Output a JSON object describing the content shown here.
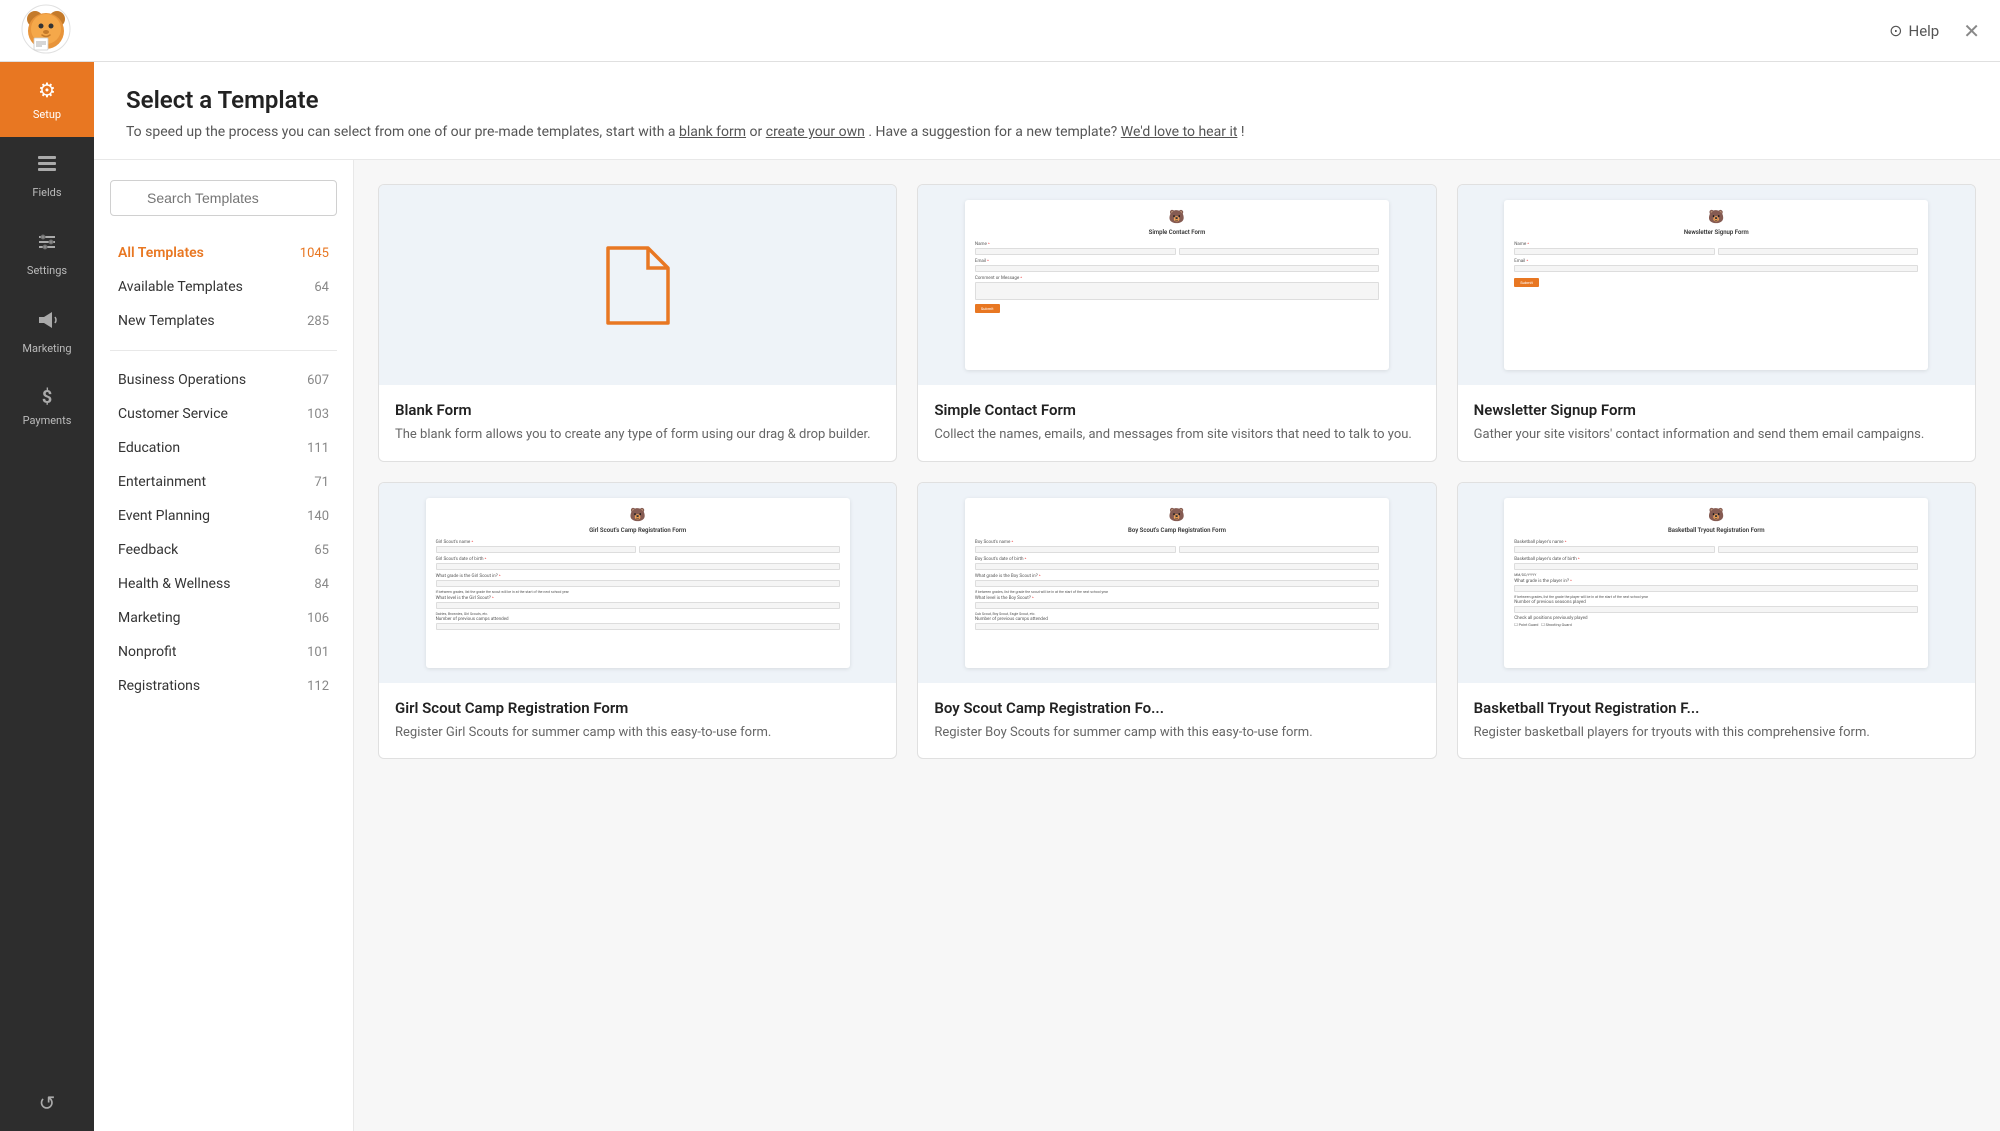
{
  "topbar": {
    "help_label": "Help",
    "close_label": "✕"
  },
  "left_nav": {
    "items": [
      {
        "id": "setup",
        "label": "Setup",
        "icon": "⚙",
        "active": true
      },
      {
        "id": "fields",
        "label": "Fields",
        "icon": "▤",
        "active": false
      },
      {
        "id": "settings",
        "label": "Settings",
        "icon": "⇌",
        "active": false
      },
      {
        "id": "marketing",
        "label": "Marketing",
        "icon": "📣",
        "active": false
      },
      {
        "id": "payments",
        "label": "Payments",
        "icon": "$",
        "active": false
      }
    ],
    "bottom_items": [
      {
        "id": "history",
        "label": "",
        "icon": "↺",
        "active": false
      }
    ]
  },
  "page": {
    "title": "Select a Template",
    "subtitle_prefix": "To speed up the process you can select from one of our pre-made templates, start with a ",
    "blank_form_link": "blank form",
    "subtitle_or": " or ",
    "create_link": "create your own",
    "subtitle_suffix": ". Have a suggestion for a new template? ",
    "suggestion_link": "We'd love to hear it",
    "subtitle_end": "!"
  },
  "filter": {
    "search_placeholder": "Search Templates",
    "filter_groups": [
      {
        "id": "all",
        "label": "All Templates",
        "count": "1045",
        "active": true
      },
      {
        "id": "available",
        "label": "Available Templates",
        "count": "64",
        "active": false
      },
      {
        "id": "new",
        "label": "New Templates",
        "count": "285",
        "active": false
      }
    ],
    "categories": [
      {
        "id": "business",
        "label": "Business Operations",
        "count": "607"
      },
      {
        "id": "customer",
        "label": "Customer Service",
        "count": "103"
      },
      {
        "id": "education",
        "label": "Education",
        "count": "111"
      },
      {
        "id": "entertainment",
        "label": "Entertainment",
        "count": "71"
      },
      {
        "id": "event",
        "label": "Event Planning",
        "count": "140"
      },
      {
        "id": "feedback",
        "label": "Feedback",
        "count": "65"
      },
      {
        "id": "health",
        "label": "Health & Wellness",
        "count": "84"
      },
      {
        "id": "marketing",
        "label": "Marketing",
        "count": "106"
      },
      {
        "id": "nonprofit",
        "label": "Nonprofit",
        "count": "101"
      },
      {
        "id": "registrations",
        "label": "Registrations",
        "count": "112"
      }
    ]
  },
  "templates": [
    {
      "id": "blank",
      "name": "Blank Form",
      "description": "The blank form allows you to create any type of form using our drag & drop builder.",
      "type": "blank"
    },
    {
      "id": "contact",
      "name": "Simple Contact Form",
      "description": "Collect the names, emails, and messages from site visitors that need to talk to you.",
      "type": "contact",
      "preview_title": "Simple Contact Form",
      "fields": [
        "Name",
        "Email",
        "Comment or Message"
      ]
    },
    {
      "id": "newsletter",
      "name": "Newsletter Signup Form",
      "description": "Gather your site visitors' contact information and send them email campaigns.",
      "type": "newsletter",
      "preview_title": "Newsletter Signup Form",
      "fields": [
        "Name",
        "Email"
      ]
    },
    {
      "id": "girlscout",
      "name": "Girl Scout Camp Registration Form",
      "description": "Register Girl Scouts for summer camp with this easy-to-use form.",
      "type": "registration",
      "preview_title": "Girl Scout's Camp Registration Form"
    },
    {
      "id": "boyscout",
      "name": "Boy Scout Camp Registration Fo...",
      "description": "Register Boy Scouts for summer camp with this easy-to-use form.",
      "type": "registration",
      "preview_title": "Boy Scout's Camp Registration Form"
    },
    {
      "id": "basketball",
      "name": "Basketball Tryout Registration F...",
      "description": "Register basketball players for tryouts with this comprehensive form.",
      "type": "registration",
      "preview_title": "Basketball Tryout Registration Form"
    }
  ]
}
